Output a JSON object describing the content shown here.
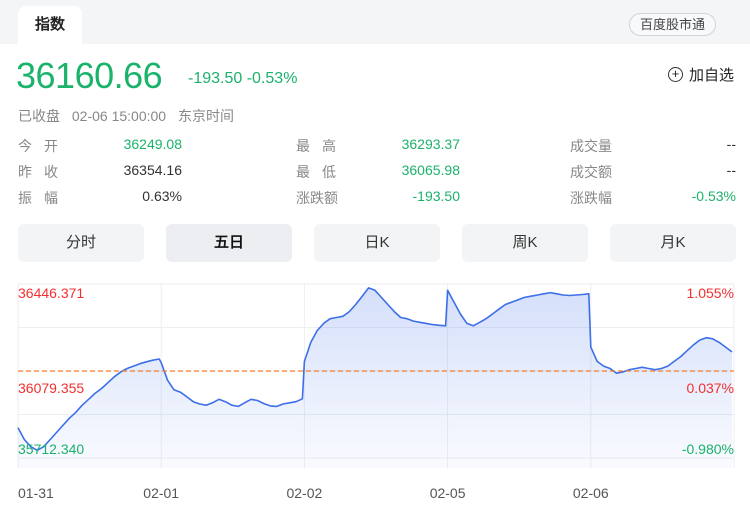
{
  "header": {
    "tab_label": "指数",
    "service_label": "百度股市通"
  },
  "quote": {
    "price": "36160.66",
    "change": "-193.50",
    "change_pct": "-0.53%",
    "add_watch_label": "加自选",
    "status": "已收盘",
    "timestamp": "02-06 15:00:00",
    "timezone": "东京时间"
  },
  "stats": {
    "open_label": "今开",
    "open": "36249.08",
    "prev_close_label": "昨收",
    "prev_close": "36354.16",
    "amplitude_label": "振幅",
    "amplitude": "0.63%",
    "high_label": "最高",
    "high": "36293.37",
    "low_label": "最低",
    "low": "36065.98",
    "change_amount_label": "涨跌额",
    "change_amount": "-193.50",
    "volume_label": "成交量",
    "volume": "--",
    "turnover_label": "成交额",
    "turnover": "--",
    "change_pct_label": "涨跌幅",
    "change_pct": "-0.53%"
  },
  "periods": [
    "分时",
    "五日",
    "日K",
    "周K",
    "月K"
  ],
  "active_period": "五日",
  "colors": {
    "up": "#f23030",
    "down": "#1bb26b",
    "line": "#3d6fe8",
    "ref": "#f07d2d"
  },
  "chart_data": {
    "type": "line",
    "y_left_labels": [
      "36446.371",
      "36079.355",
      "35712.340"
    ],
    "y_right_labels": [
      "1.055%",
      "0.037%",
      "-0.980%"
    ],
    "ylim": [
      35712.34,
      36446.371
    ],
    "reference_value": 36079.355,
    "x_labels": [
      "01-31",
      "02-01",
      "02-02",
      "02-05",
      "02-06"
    ],
    "days": [
      {
        "label": "01-31",
        "values": [
          35840,
          35790,
          35760,
          35745,
          35760,
          35790,
          35820,
          35850,
          35880,
          35905,
          35935,
          35960,
          35985,
          36005,
          36030,
          36055,
          36075,
          36090,
          36100,
          36110,
          36118,
          36125,
          36130
        ]
      },
      {
        "label": "02-01",
        "values": [
          36115,
          36040,
          36000,
          35990,
          35970,
          35950,
          35940,
          35935,
          35945,
          35960,
          35950,
          35935,
          35930,
          35945,
          35960,
          35955,
          35942,
          35932,
          35930,
          35940,
          35945,
          35950,
          35962
        ]
      },
      {
        "label": "02-02",
        "values": [
          36120,
          36200,
          36250,
          36280,
          36300,
          36305,
          36310,
          36330,
          36360,
          36395,
          36430,
          36420,
          36390,
          36360,
          36330,
          36305,
          36300,
          36290,
          36285,
          36280,
          36275,
          36272,
          36270
        ]
      },
      {
        "label": "02-05",
        "values": [
          36420,
          36370,
          36320,
          36280,
          36270,
          36285,
          36300,
          36320,
          36340,
          36360,
          36370,
          36380,
          36390,
          36395,
          36400,
          36405,
          36410,
          36405,
          36400,
          36398,
          36400,
          36402,
          36405
        ]
      },
      {
        "label": "02-06",
        "values": [
          36180,
          36120,
          36100,
          36090,
          36070,
          36075,
          36085,
          36090,
          36095,
          36090,
          36085,
          36090,
          36100,
          36120,
          36140,
          36165,
          36190,
          36210,
          36220,
          36215,
          36200,
          36180,
          36160
        ]
      }
    ]
  }
}
